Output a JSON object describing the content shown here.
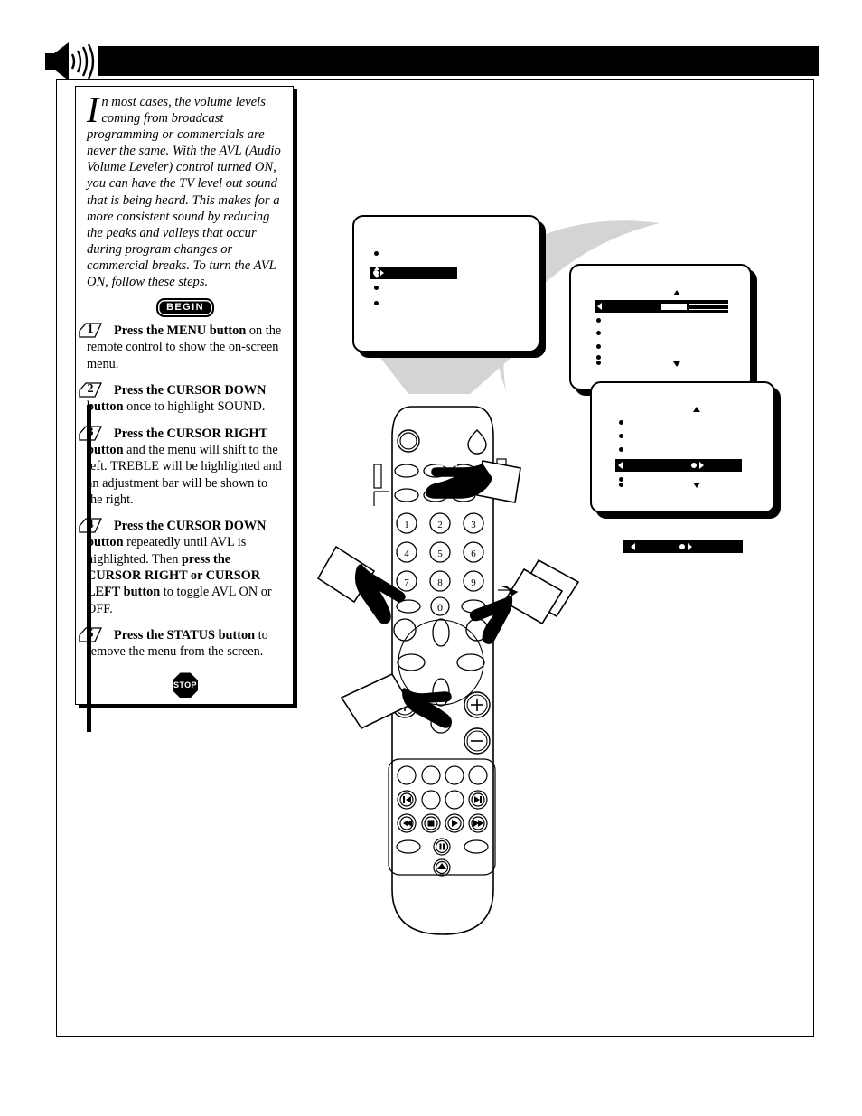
{
  "header": {
    "title": "",
    "icon": "speaker-volume-icon"
  },
  "instructions": {
    "intro_dropcap": "I",
    "intro_text": "n most cases, the volume levels coming from broadcast programming or commercials are never the same.  With the AVL (Audio Volume Leveler) control turned ON, you can have the TV level out sound that is being heard.  This makes for a more consistent sound by reducing the peaks and valleys that occur during program changes or commercial breaks.  To turn the AVL ON, follow these steps.",
    "begin_label": "BEGIN",
    "stop_label": "STOP",
    "steps": [
      {
        "number": "1",
        "lead": "Press the MENU button",
        "rest": " on the remote control to show the on-screen menu."
      },
      {
        "number": "2",
        "lead": "Press the CURSOR DOWN button",
        "rest": " once to highlight SOUND."
      },
      {
        "number": "3",
        "lead": "Press the CURSOR RIGHT button",
        "rest": " and the menu will shift to the left. TREBLE will be highlighted and an adjustment bar will be shown to the right."
      },
      {
        "number": "4",
        "lead": "Press the CURSOR DOWN button",
        "mid": " repeatedly until AVL is highlighted.  Then ",
        "lead2": "press the CURSOR RIGHT or CURSOR LEFT button",
        "rest": " to toggle AVL ON or OFF."
      },
      {
        "number": "5",
        "lead": "Press the STATUS button",
        "rest": " to remove the menu from the screen."
      }
    ]
  },
  "tv_screens": [
    {
      "id": "main-menu",
      "name": "on-screen-main-menu",
      "rows": [
        "",
        "",
        "",
        ""
      ],
      "highlighted_index": 1,
      "highlight_label": "",
      "cursor": "four-way-cursor-indicator"
    },
    {
      "id": "sound-menu",
      "name": "sound-menu-treble-highlighted",
      "rows": [
        "",
        "",
        "",
        "",
        ""
      ],
      "highlighted_index": 0,
      "highlight_label": "",
      "has_adjustment_bar": true,
      "bar_fill_percent": 55,
      "scroll_up": "▲",
      "scroll_down": "▼"
    },
    {
      "id": "avl-menu",
      "name": "sound-menu-avl-highlighted",
      "rows": [
        "",
        "",
        "",
        "",
        ""
      ],
      "highlighted_index": 3,
      "highlight_label": "",
      "has_toggle": true,
      "scroll_up": "▲",
      "scroll_down": "▼"
    }
  ],
  "detail_bar": {
    "name": "avl-toggle-detail-bar",
    "label": "",
    "left_arrow": "◀",
    "toggle": "●▶"
  },
  "remote": {
    "name": "tv-remote-control",
    "keypad": [
      "1",
      "2",
      "3",
      "4",
      "5",
      "6",
      "7",
      "8",
      "9",
      "0"
    ],
    "plus_label": "+",
    "minus_label": "−",
    "hands": [
      "pointing-hand-menu",
      "pointing-hand-cursor-down-left",
      "pointing-hand-cursor-right",
      "pointing-hand-status"
    ],
    "transport": [
      "skip-back",
      "skip-forward",
      "rewind",
      "stop",
      "play",
      "fast-forward",
      "pause",
      "eject"
    ]
  },
  "colors": {
    "ink": "#000000",
    "paper": "#ffffff",
    "connector_gray": "#d4d4d4"
  }
}
